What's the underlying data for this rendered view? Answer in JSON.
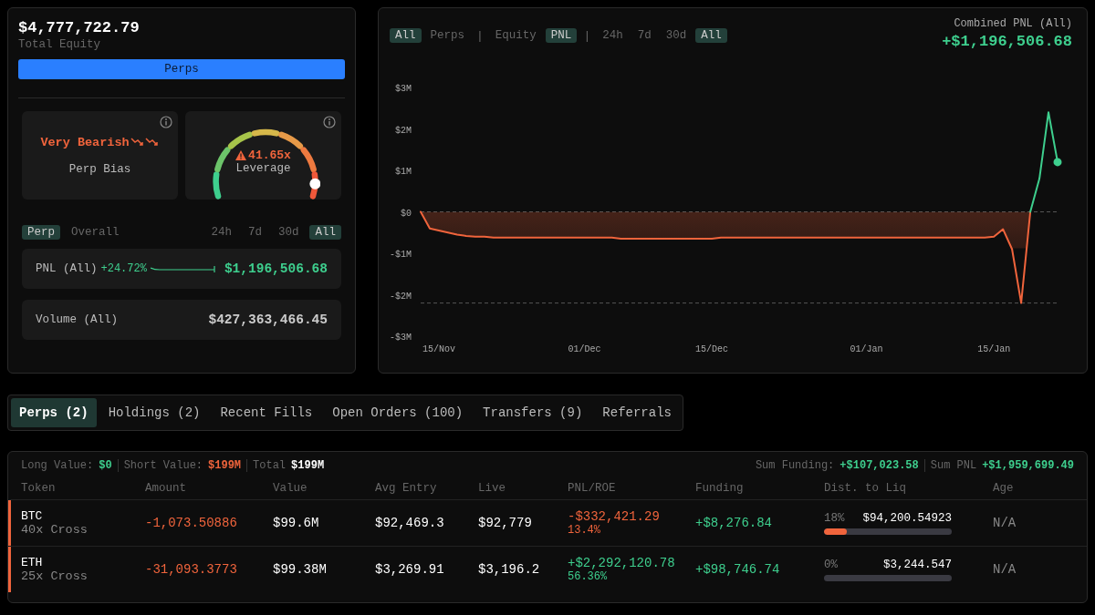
{
  "account": {
    "equity": "$4,777,722.79",
    "equity_label": "Total Equity",
    "mode_button": "Perps",
    "bias": {
      "value": "Very Bearish",
      "label": "Perp Bias"
    },
    "leverage": {
      "value": "41.65x",
      "label": "Leverage",
      "level": 0.92
    },
    "scope_toggles": [
      {
        "label": "Perp",
        "selected": true
      },
      {
        "label": "Overall",
        "selected": false
      }
    ],
    "range_toggles": [
      {
        "label": "24h",
        "selected": false
      },
      {
        "label": "7d",
        "selected": false
      },
      {
        "label": "30d",
        "selected": false
      },
      {
        "label": "All",
        "selected": true
      }
    ],
    "pnl": {
      "label": "PNL (All)",
      "change": "+24.72%",
      "value": "$1,196,506.68"
    },
    "volume": {
      "label": "Volume (All)",
      "value": "$427,363,466.45"
    }
  },
  "chart_panel": {
    "toggles": [
      {
        "kind": "toggle",
        "label": "All",
        "selected": true
      },
      {
        "kind": "toggle",
        "label": "Perps",
        "selected": false
      },
      {
        "kind": "separator",
        "label": "|"
      },
      {
        "kind": "toggle",
        "label": "Equity",
        "selected": false
      },
      {
        "kind": "toggle",
        "label": "PNL",
        "selected": true
      },
      {
        "kind": "separator",
        "label": "|"
      },
      {
        "kind": "toggle",
        "label": "24h",
        "selected": false
      },
      {
        "kind": "toggle",
        "label": "7d",
        "selected": false
      },
      {
        "kind": "toggle",
        "label": "30d",
        "selected": false
      },
      {
        "kind": "toggle",
        "label": "All",
        "selected": true
      }
    ],
    "combined_label": "Combined PNL (All)",
    "combined_value": "+$1,196,506.68",
    "chart_data": {
      "type": "line",
      "categories": [
        null,
        null,
        "15/Nov",
        null,
        null,
        null,
        null,
        null,
        null,
        null,
        null,
        null,
        null,
        null,
        null,
        null,
        null,
        null,
        "01/Dec",
        null,
        null,
        null,
        null,
        null,
        null,
        null,
        null,
        null,
        null,
        null,
        null,
        null,
        "15/Dec",
        null,
        null,
        null,
        null,
        null,
        null,
        null,
        null,
        null,
        null,
        null,
        null,
        null,
        null,
        null,
        null,
        "01/Jan",
        null,
        null,
        null,
        null,
        null,
        null,
        null,
        null,
        null,
        null,
        null,
        null,
        null,
        "15/Jan",
        null,
        null,
        null,
        null,
        null,
        null,
        null
      ],
      "series": [
        {
          "color": "#f0643c",
          "values": [
            0,
            -400000,
            -450000,
            -500000,
            -550000,
            -580000,
            -600000,
            -600000,
            -620000,
            -620000,
            -620000,
            -620000,
            -620000,
            -620000,
            -620000,
            -620000,
            -620000,
            -620000,
            -620000,
            -620000,
            -620000,
            -620000,
            -650000,
            -650000,
            -650000,
            -650000,
            -650000,
            -650000,
            -650000,
            -650000,
            -650000,
            -650000,
            -650000,
            -620000,
            -620000,
            -620000,
            -620000,
            -620000,
            -620000,
            -620000,
            -620000,
            -620000,
            -620000,
            -620000,
            -620000,
            -620000,
            -620000,
            -620000,
            -620000,
            -620000,
            -620000,
            -620000,
            -620000,
            -620000,
            -620000,
            -620000,
            -620000,
            -620000,
            -620000,
            -620000,
            -620000,
            -620000,
            -620000,
            -600000,
            -420000,
            -900000,
            -2200000,
            0,
            null,
            null,
            null
          ]
        },
        {
          "color": "#3ecf8e",
          "values": [
            null,
            null,
            null,
            null,
            null,
            null,
            null,
            null,
            null,
            null,
            null,
            null,
            null,
            null,
            null,
            null,
            null,
            null,
            null,
            null,
            null,
            null,
            null,
            null,
            null,
            null,
            null,
            null,
            null,
            null,
            null,
            null,
            null,
            null,
            null,
            null,
            null,
            null,
            null,
            null,
            null,
            null,
            null,
            null,
            null,
            null,
            null,
            null,
            null,
            null,
            null,
            null,
            null,
            null,
            null,
            null,
            null,
            null,
            null,
            null,
            null,
            null,
            null,
            null,
            null,
            null,
            null,
            0,
            800000,
            2400000,
            1200000
          ]
        }
      ],
      "ylim": [
        -3000000,
        3000000
      ],
      "yticks": [
        {
          "value": 3000000,
          "label": "$3M"
        },
        {
          "value": 2000000,
          "label": "$2M"
        },
        {
          "value": 1000000,
          "label": "$1M"
        },
        {
          "value": 0,
          "label": "$0"
        },
        {
          "value": -1000000,
          "label": "-$1M"
        },
        {
          "value": -2000000,
          "label": "-$2M"
        },
        {
          "value": -3000000,
          "label": "-$3M"
        }
      ]
    }
  },
  "tabs": [
    {
      "label": "Perps (2)",
      "selected": true
    },
    {
      "label": "Holdings (2)",
      "selected": false
    },
    {
      "label": "Recent Fills",
      "selected": false
    },
    {
      "label": "Open Orders (100)",
      "selected": false
    },
    {
      "label": "Transfers (9)",
      "selected": false
    },
    {
      "label": "Referrals",
      "selected": false
    }
  ],
  "positions": {
    "summary_left": [
      {
        "label": "Long Value:",
        "value": "$0",
        "color": "#3ecf8e"
      },
      {
        "label": "Short Value:",
        "value": "$199M",
        "color": "#f0643c"
      },
      {
        "label": "Total",
        "value": "$199M",
        "color": "#ffffff"
      }
    ],
    "summary_right": [
      {
        "label": "Sum Funding:",
        "value": "+$107,023.58"
      },
      {
        "label": "Sum PNL",
        "value": "+$1,959,699.49"
      }
    ],
    "columns": [
      "Token",
      "Amount",
      "Value",
      "Avg Entry",
      "Live",
      "PNL/ROE",
      "Funding",
      "Dist. to Liq",
      "Age"
    ],
    "rows": [
      {
        "color": "#f0643c",
        "token": "BTC",
        "mode": "40x Cross",
        "amount": "-1,073.50886",
        "value": "$99.6M",
        "avg_entry": "$92,469.3",
        "live": "$92,779",
        "pnl": {
          "value": "-$332,421.29",
          "roe": "13.4%",
          "color": "#f0643c"
        },
        "funding": "+$8,276.84",
        "liq_pct": "18%",
        "liq_price": "$94,200.54923",
        "level": 0.18,
        "age": "N/A"
      },
      {
        "color": "#f0643c",
        "token": "ETH",
        "mode": "25x Cross",
        "amount": "-31,093.3773",
        "value": "$99.38M",
        "avg_entry": "$3,269.91",
        "live": "$3,196.2",
        "pnl": {
          "value": "+$2,292,120.78",
          "roe": "56.36%",
          "color": "#3ecf8e"
        },
        "funding": "+$98,746.74",
        "liq_pct": "0%",
        "liq_price": "$3,244.547",
        "level": 0,
        "age": "N/A"
      }
    ]
  }
}
